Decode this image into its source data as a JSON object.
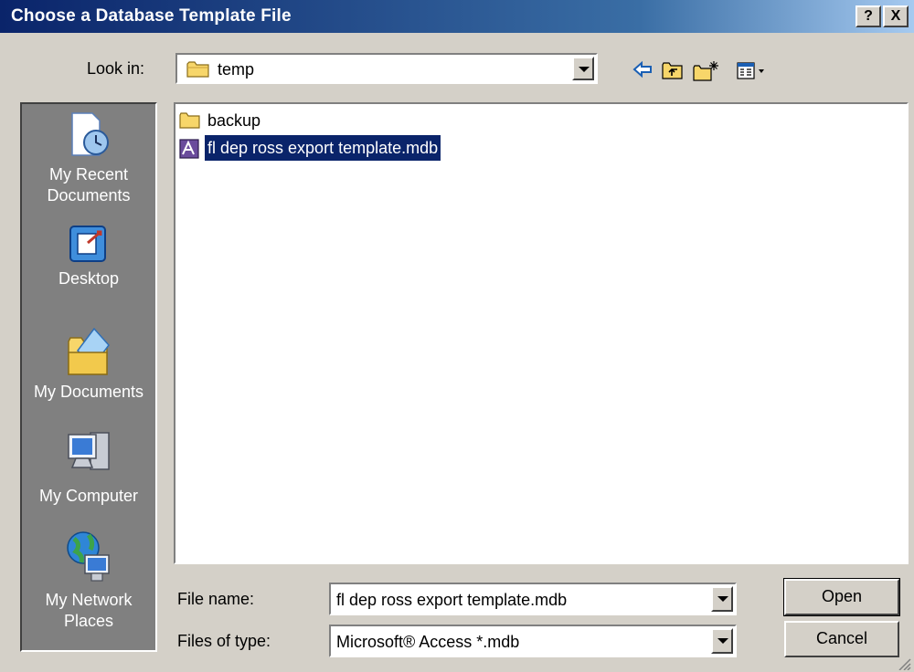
{
  "window": {
    "title": "Choose a Database Template File",
    "help_glyph": "?",
    "close_glyph": "X"
  },
  "lookin": {
    "label": "Look in:",
    "value": "temp"
  },
  "toolbar": {
    "icons": [
      "back-arrow-icon",
      "up-one-level-icon",
      "create-new-folder-icon",
      "view-menu-icon"
    ]
  },
  "places": [
    {
      "name": "recent",
      "label_line1": "My Recent",
      "label_line2": "Documents",
      "icon": "recent-documents-icon"
    },
    {
      "name": "desktop",
      "label_line1": "Desktop",
      "label_line2": "",
      "icon": "desktop-icon"
    },
    {
      "name": "my-documents",
      "label_line1": "My Documents",
      "label_line2": "",
      "icon": "my-documents-icon"
    },
    {
      "name": "my-computer",
      "label_line1": "My Computer",
      "label_line2": "",
      "icon": "my-computer-icon"
    },
    {
      "name": "network",
      "label_line1": "My Network",
      "label_line2": "Places",
      "icon": "network-places-icon"
    }
  ],
  "files": [
    {
      "name": "backup",
      "type": "folder",
      "selected": false
    },
    {
      "name": "fl dep ross export template.mdb",
      "type": "access-database",
      "selected": true
    }
  ],
  "filename": {
    "label": "File name:",
    "value": "fl dep ross export template.mdb"
  },
  "filetype": {
    "label": "Files of type:",
    "value": "Microsoft® Access *.mdb"
  },
  "buttons": {
    "open": "Open",
    "cancel": "Cancel"
  },
  "colors": {
    "title_bar": "#0a246a",
    "selection": "#0a246a",
    "places_bar": "#808080",
    "dialog_bg": "#d4d0c8"
  }
}
